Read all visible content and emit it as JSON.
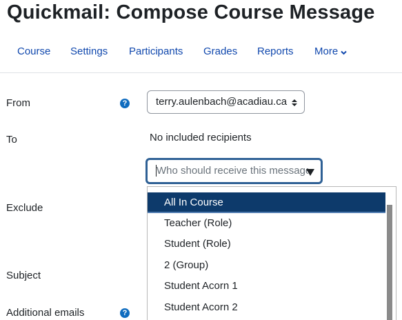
{
  "page": {
    "title": "Quickmail: Compose Course Message"
  },
  "nav": {
    "items": [
      {
        "label": "Course"
      },
      {
        "label": "Settings"
      },
      {
        "label": "Participants"
      },
      {
        "label": "Grades"
      },
      {
        "label": "Reports"
      },
      {
        "label": "More"
      }
    ]
  },
  "form": {
    "from_label": "From",
    "from_value": "terry.aulenbach@acadiau.ca",
    "to_label": "To",
    "to_status": "No included recipients",
    "recipient_placeholder": "Who should receive this message",
    "exclude_label": "Exclude",
    "subject_label": "Subject",
    "additional_emails_label": "Additional emails",
    "help_icon_glyph": "?"
  },
  "dropdown": {
    "selected_index": 0,
    "options": [
      "All In Course",
      "Teacher (Role)",
      "Student (Role)",
      "2 (Group)",
      "Student Acorn 1",
      "Student Acorn 2"
    ]
  },
  "colors": {
    "link": "#0f47ad",
    "help_icon": "#0f6cbf",
    "selected_option_bg": "#0d3a6b",
    "focus_border": "#2e6095"
  },
  "icons": {
    "help": "question-circle-icon",
    "more": "chevron-down-icon",
    "select": "sort-arrows-icon",
    "combobox": "caret-down-icon"
  }
}
